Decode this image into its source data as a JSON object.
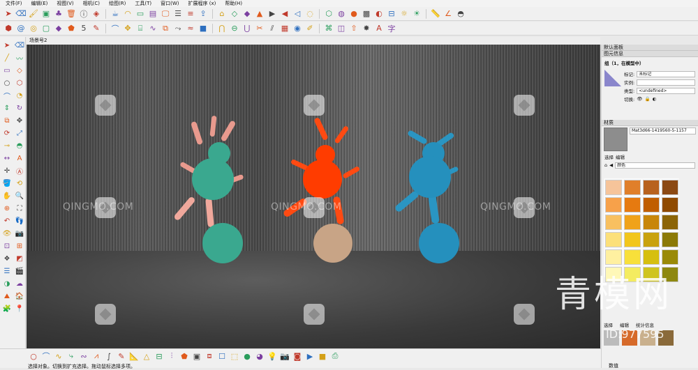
{
  "menu": [
    "文件(F)",
    "编辑(E)",
    "视图(V)",
    "相机(C)",
    "绘图(R)",
    "工具(T)",
    "窗口(W)",
    "扩展程序 (x)",
    "帮助(H)"
  ],
  "toolbar1_icons": [
    "select-icon",
    "eraser-icon",
    "paint-icon",
    "cube-icon",
    "tree-icon",
    "trash-icon",
    "info-icon",
    "model-icon",
    "teapot-icon",
    "fillet-icon",
    "outline-icon",
    "window-icon",
    "monitor-icon",
    "layers-icon",
    "stack-icon",
    "upload-icon",
    "home-icon",
    "iso-icon",
    "top-view-icon",
    "front-view-icon",
    "right-view-icon",
    "back-view-icon",
    "left-view-icon",
    "xray-icon",
    "wire-icon",
    "hidden-icon",
    "shaded-icon",
    "texture-icon",
    "mono-icon",
    "section-icon",
    "compass-icon",
    "sun-icon",
    "ruler-icon",
    "angle-icon",
    "protractor-icon"
  ],
  "toolbar2_icons": [
    "hexagon-icon",
    "spiral-icon",
    "ring-icon",
    "frame-icon",
    "diamond-icon",
    "shape-icon",
    "fifty-icon",
    "pen-icon",
    "arc-icon",
    "move-icon",
    "stairs-icon",
    "curve-icon",
    "offset-icon",
    "sweep-icon",
    "ribbon-icon",
    "solid-icon",
    "intersect-icon",
    "subtract-icon",
    "union-icon",
    "trim-icon",
    "split-icon",
    "grid-icon",
    "smooth-icon",
    "draw-icon",
    "fold-icon",
    "shell-icon",
    "push-icon",
    "explode-icon",
    "text3d-icon"
  ],
  "toolbar2_text": "字",
  "scene_tab": "场景号2",
  "left_tools": [
    "select-arrow-icon",
    "eraser-icon",
    "line-icon",
    "freehand-icon",
    "rect-icon",
    "rotated-rect-icon",
    "circle-icon",
    "polygon-icon",
    "arc-icon",
    "pie-icon",
    "push-pull-icon",
    "follow-me-icon",
    "offset-icon",
    "move-icon",
    "rotate-icon",
    "scale-icon",
    "tape-icon",
    "protractor-icon",
    "dimension-icon",
    "text-icon",
    "axes-icon",
    "3dtext-icon",
    "paint-bucket-icon",
    "orbit-icon",
    "pan-icon",
    "zoom-icon",
    "zoom-window-icon",
    "zoom-extents-icon",
    "prev-view-icon",
    "walk-icon",
    "look-around-icon",
    "position-camera-icon",
    "section-plane-icon",
    "section-display-icon",
    "components-icon",
    "styles-icon",
    "layers-icon",
    "scenes-icon",
    "shadows-icon",
    "fog-icon",
    "sandbox-icon",
    "warehouse-icon",
    "extension-icon",
    "location-icon"
  ],
  "watermarks": {
    "qingmo": "QINGMO.COM",
    "big_cn": "青模网",
    "id_text": "ID:977595"
  },
  "panel": {
    "title": "默认面板",
    "entity_info": "图元信息",
    "entity_desc": "组（1，在模型中）",
    "tag_label": "标记:",
    "tag_value": "未标记",
    "instance_label": "实例:",
    "instance_value": "",
    "type_label": "类型:",
    "type_value": "<undefined>",
    "toggle_label": "切换:",
    "materials": "材质",
    "material_name": "Mat3d66-1419560-5-1157",
    "select_tab": "选择",
    "edit_tab": "编辑",
    "color_dropdown": "颜色",
    "bottom_tabs": [
      "选择",
      "编辑",
      "统计信息"
    ],
    "bottom_label": "数值"
  },
  "swatch_colors": [
    "#f6c49a",
    "#e07f2a",
    "#b8621e",
    "#8c4a14",
    "#f7a14a",
    "#e67a10",
    "#c05e00",
    "#8f4a00",
    "#f8c060",
    "#f0a21a",
    "#c8860a",
    "#8c6508",
    "#fce07a",
    "#f2c61c",
    "#c9a20e",
    "#8c7a08",
    "#fff0a0",
    "#f8e03a",
    "#d6bf10",
    "#9a8a08",
    "#fff8b8",
    "#f4ec60",
    "#cfc420",
    "#8e8810"
  ],
  "statusbar": {
    "message": "选择对象。切换到扩充选择。拖动鼠标选择多项。"
  },
  "status_icons": [
    "circle-icon",
    "arc-icon",
    "curve-icon",
    "path-icon",
    "wave-icon",
    "zigzag-icon",
    "spline-icon",
    "edit-icon",
    "measure-icon",
    "triangle-icon",
    "section-icon",
    "align-icon",
    "shape-icon",
    "cube-icon",
    "cubes-icon",
    "box-icon",
    "wire-box-icon",
    "ball-icon",
    "render-icon",
    "light-icon",
    "camera-icon",
    "material-icon",
    "play-icon",
    "stop-icon",
    "snapshot-icon"
  ]
}
